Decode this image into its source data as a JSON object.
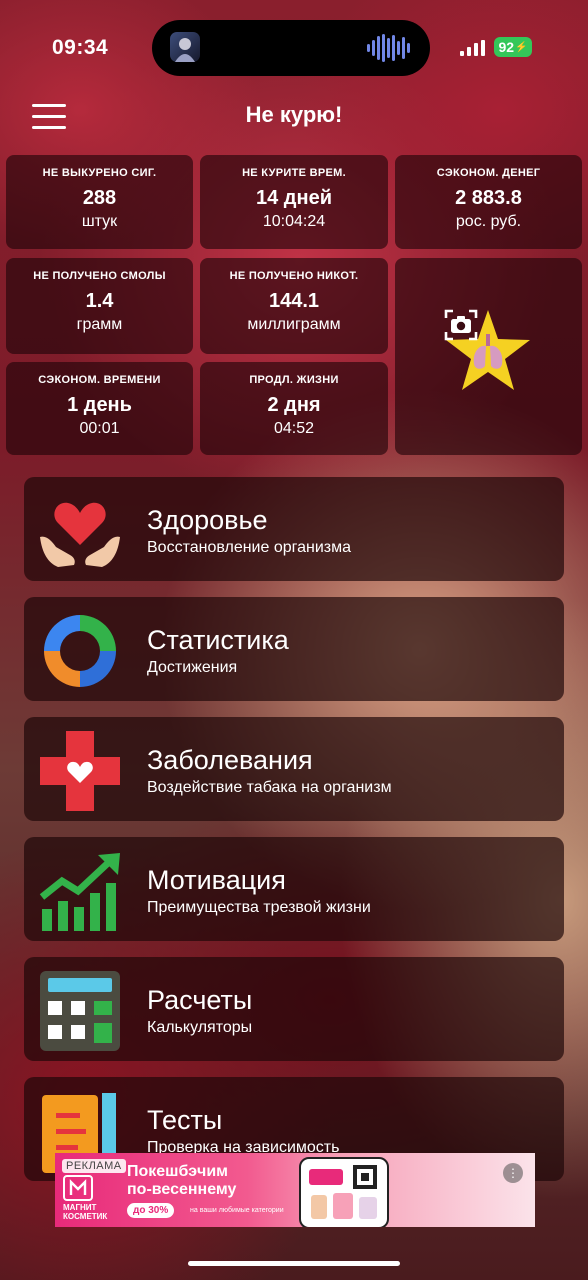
{
  "status": {
    "time": "09:34",
    "battery": "92"
  },
  "header": {
    "title": "Не курю!",
    "menu_icon": "hamburger-icon"
  },
  "stats": [
    {
      "label": "НЕ ВЫКУРЕНО СИГ.",
      "value": "288",
      "unit": "штук"
    },
    {
      "label": "НЕ КУРИТЕ ВРЕМ.",
      "value": "14 дней",
      "unit": "10:04:24"
    },
    {
      "label": "СЭКОНОМ. ДЕНЕГ",
      "value": "2 883.8",
      "unit": "рос. руб."
    },
    {
      "label": "НЕ ПОЛУЧЕНО СМОЛЫ",
      "value": "1.4",
      "unit": "грамм"
    },
    {
      "label": "НЕ ПОЛУЧЕНО НИКОТ.",
      "value": "144.1",
      "unit": "миллиграмм"
    },
    {
      "label": "СЭКОНОМ. ВРЕМЕНИ",
      "value": "1 день",
      "unit": "00:01"
    },
    {
      "label": "ПРОДЛ. ЖИЗНИ",
      "value": "2 дня",
      "unit": "04:52"
    }
  ],
  "achievement": {
    "icon": "star-lungs-icon",
    "camera_icon": "camera-icon",
    "star_color": "#f5d122"
  },
  "menu": [
    {
      "title": "Здоровье",
      "subtitle": "Восстановление организма",
      "icon": "heart-hands-icon"
    },
    {
      "title": "Статистика",
      "subtitle": "Достижения",
      "icon": "ring-chart-icon"
    },
    {
      "title": "Заболевания",
      "subtitle": "Воздействие табака на организм",
      "icon": "medical-cross-icon"
    },
    {
      "title": "Мотивация",
      "subtitle": "Преимущества трезвой жизни",
      "icon": "growth-chart-icon"
    },
    {
      "title": "Расчеты",
      "subtitle": "Калькуляторы",
      "icon": "calculator-icon"
    },
    {
      "title": "Тесты",
      "subtitle": "Проверка на зависимость",
      "icon": "test-pencil-icon"
    }
  ],
  "ad": {
    "badge": "РЕКЛАМА",
    "brand_line1": "МАГНИТ",
    "brand_line2": "КОСМЕТИК",
    "headline_line1": "Покешбэчим",
    "headline_line2": "по-весеннему",
    "discount": "до 30%",
    "note": "на ваши любимые категории"
  },
  "colors": {
    "accent_green": "#34c759",
    "ad_pink": "#e82a7a",
    "heart_red": "#e5343d"
  }
}
